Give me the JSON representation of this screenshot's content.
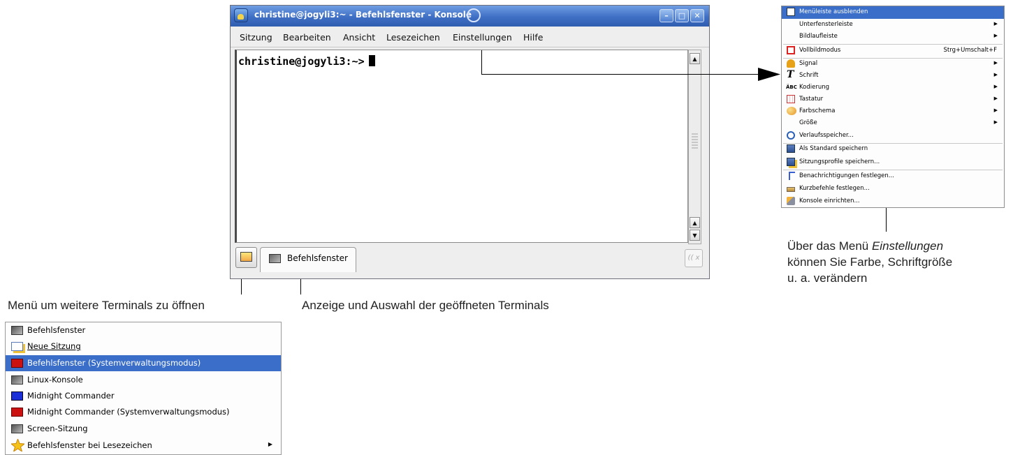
{
  "window": {
    "title": "christine@jogyli3:~ - Befehlsfenster - Konsole",
    "minimize": "–",
    "maximize": "□",
    "close": "✕",
    "menu": [
      "Sitzung",
      "Bearbeiten",
      "Ansicht",
      "Lesezeichen",
      "Einstellungen",
      "Hilfe"
    ],
    "prompt": "christine@jogyli3:~>",
    "scroll_up": "▲",
    "scroll_down": "▼",
    "tab_label": "Befehlsfenster",
    "close_tab": "(( x"
  },
  "settings_menu": {
    "items": [
      {
        "label": "Menüleiste ausblenden",
        "icon": "menubar-icon",
        "highlighted": true
      },
      {
        "label": "Unterfensterleiste",
        "submenu": true
      },
      {
        "label": "Bildlaufleiste",
        "submenu": true
      },
      {
        "label": "Vollbildmodus",
        "icon": "fullscreen-icon",
        "shortcut": "Strg+Umschalt+F"
      },
      {
        "label": "Signal",
        "icon": "bell-icon",
        "submenu": true
      },
      {
        "label": "Schrift",
        "icon": "font-icon",
        "submenu": true
      },
      {
        "label": "Kodierung",
        "icon": "encoding-icon",
        "submenu": true
      },
      {
        "label": "Tastatur",
        "icon": "keyboard-icon",
        "submenu": true
      },
      {
        "label": "Farbschema",
        "icon": "palette-icon",
        "submenu": true
      },
      {
        "label": "Größe",
        "submenu": true
      },
      {
        "label": "Verlaufsspeicher...",
        "icon": "history-icon"
      },
      {
        "label": "Als Standard speichern",
        "icon": "save-icon"
      },
      {
        "label": "Sitzungsprofile speichern...",
        "icon": "save-profile-icon"
      },
      {
        "label": "Benachrichtigungen festlegen...",
        "icon": "notification-icon"
      },
      {
        "label": "Kurzbefehle festlegen...",
        "icon": "shortcut-icon"
      },
      {
        "label": "Konsole einrichten...",
        "icon": "configure-icon"
      }
    ],
    "font_glyph": "T",
    "encoding_glyph": "ÄBC"
  },
  "session_menu": {
    "items": [
      {
        "label": "Befehlsfenster",
        "icon": "terminal-icon"
      },
      {
        "label": "Neue Sitzung",
        "icon": "new-session-icon"
      },
      {
        "label": "Befehlsfenster (Systemverwaltungsmodus)",
        "icon": "root-terminal-icon",
        "highlighted": true
      },
      {
        "label": "Linux-Konsole",
        "icon": "terminal-icon"
      },
      {
        "label": "Midnight Commander",
        "icon": "mc-icon"
      },
      {
        "label": "Midnight Commander (Systemverwaltungsmodus)",
        "icon": "root-terminal-icon"
      },
      {
        "label": "Screen-Sitzung",
        "icon": "terminal-icon"
      },
      {
        "label": "Befehlsfenster bei Lesezeichen",
        "icon": "star-icon",
        "submenu": true
      }
    ]
  },
  "callouts": {
    "settings_line1_pre": "Über das Menü ",
    "settings_line1_em": "Einstellungen",
    "settings_line2": "können Sie Farbe, Schriftgröße",
    "settings_line3": "u. a. verändern",
    "new_terminal_menu": "Menü um weitere Terminals zu öffnen",
    "tabs": "Anzeige und Auswahl der geöffneten Terminals"
  },
  "colors": {
    "titlebar": "#3f6fc4",
    "highlight": "#3a6ec8",
    "root_terminal_red": "#cc1111",
    "mc_blue": "#1a2fd8"
  },
  "submenu_arrow": "▶"
}
